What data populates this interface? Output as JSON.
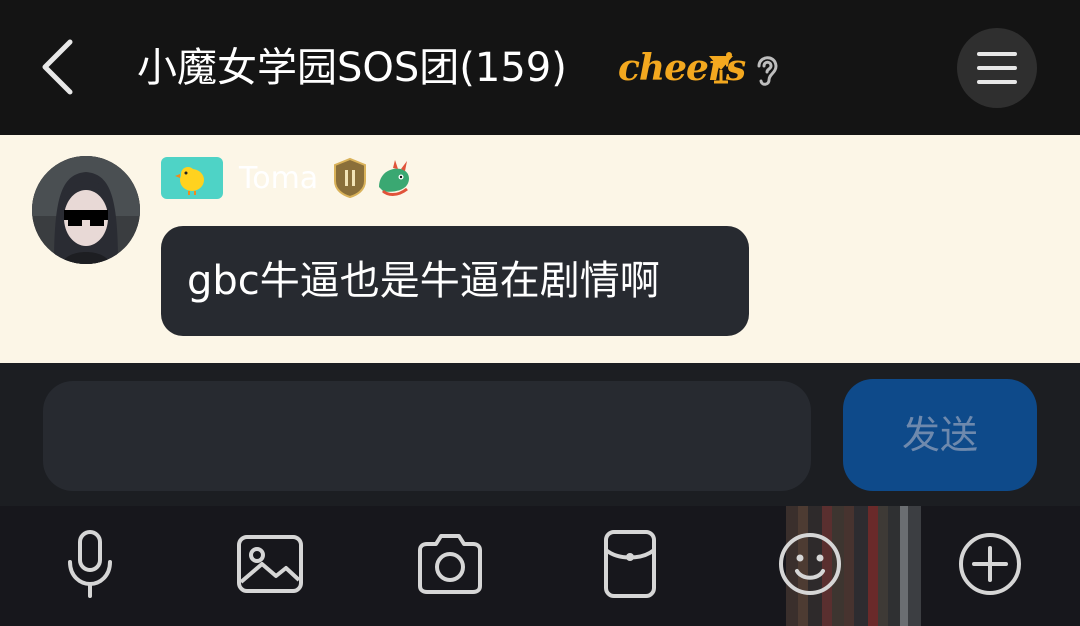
{
  "header": {
    "title": "小魔女学园SOS团(159)",
    "title_badge": "cheers",
    "icons": [
      "back-arrow-icon",
      "cocktail-glass-icon",
      "ear-icon",
      "menu-icon"
    ]
  },
  "message": {
    "sender_name": "Toma",
    "level_badge_icon": "chick-icon",
    "medal_icon": "medal-icon",
    "dragon_icon": "dragon-icon",
    "text": "gbc牛逼也是牛逼在剧情啊"
  },
  "composer": {
    "input_value": "",
    "send_label": "发送"
  },
  "toolbar": {
    "items": [
      "microphone-icon",
      "image-icon",
      "camera-icon",
      "red-packet-icon",
      "emoji-icon",
      "plus-icon"
    ]
  },
  "colors": {
    "header_bg": "#141414",
    "message_area_bg": "#fcf6e7",
    "bubble_bg": "#272a30",
    "send_button_bg": "#0e4a8a",
    "cheers_orange": "#f3a81f",
    "level_badge": "#4ed3c6"
  }
}
